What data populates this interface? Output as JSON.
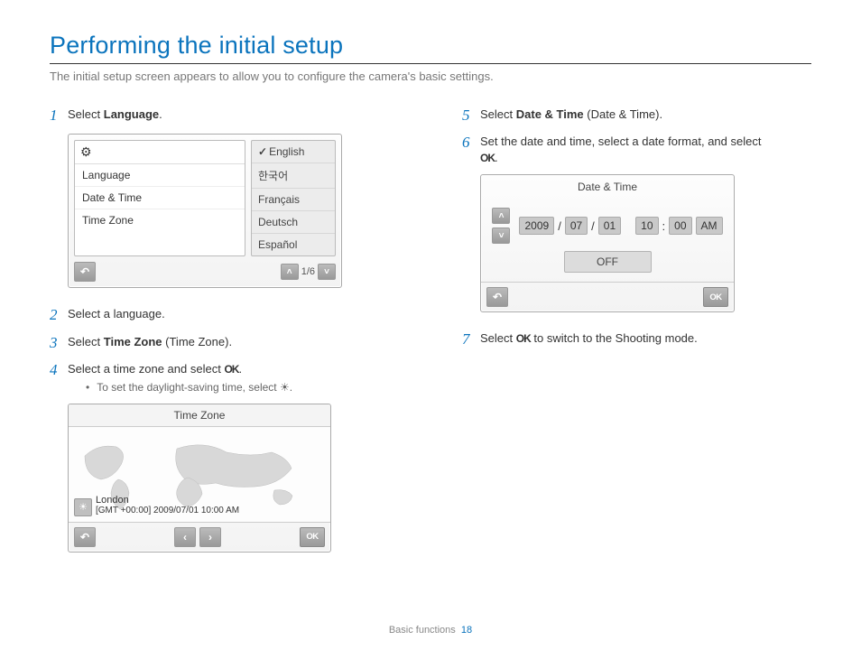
{
  "title": "Performing the initial setup",
  "subtitle": "The initial setup screen appears to allow you to configure the camera's basic settings.",
  "steps": {
    "s1": {
      "prefix": "Select ",
      "bold": "Language",
      "suffix": "."
    },
    "s2": {
      "text": "Select a language."
    },
    "s3": {
      "prefix": "Select ",
      "bold": "Time Zone",
      "paren": " (Time Zone)."
    },
    "s4": {
      "prefix": "Select a time zone and select ",
      "ok": "OK",
      "suffix": ".",
      "bullet": "To set the daylight-saving time, select "
    },
    "s5": {
      "prefix": "Select ",
      "bold": "Date & Time",
      "paren": " (Date & Time)."
    },
    "s6": {
      "text": "Set the date and time, select a date format, and select ",
      "ok": "OK",
      "suffix": "."
    },
    "s7": {
      "prefix": "Select ",
      "ok": "OK",
      "suffix": " to switch to the Shooting mode."
    }
  },
  "lang_panel": {
    "menu": [
      "Language",
      "Date & Time",
      "Time Zone"
    ],
    "options": [
      "English",
      "한국어",
      "Français",
      "Deutsch",
      "Español"
    ],
    "pager": "1/6"
  },
  "tz_panel": {
    "title": "Time Zone",
    "city": "London",
    "gmt": "[GMT +00:00] 2009/07/01 10:00 AM"
  },
  "dt_panel": {
    "title": "Date & Time",
    "year": "2009",
    "mon": "07",
    "day": "01",
    "hour": "10",
    "min": "00",
    "ampm": "AM",
    "off": "OFF"
  },
  "footer": {
    "section": "Basic functions",
    "page": "18"
  }
}
